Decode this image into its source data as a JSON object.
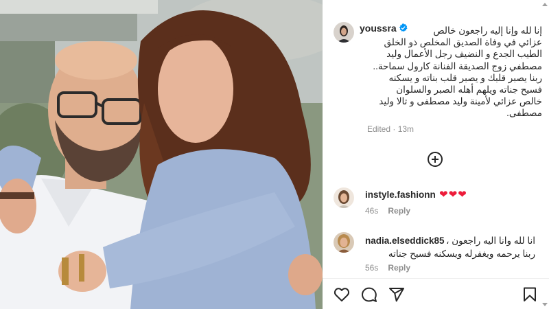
{
  "post": {
    "photo_alt": "Photo of two people embracing",
    "author": {
      "username": "youssra",
      "verified": true
    },
    "caption_lines": [
      "إنا لله وإنا إليه راجعون خالص",
      "عزائي في وفاة الصديق المخلص ذو الخلق",
      "الطيب الجدع و النضيف رجل الأعمال وليد",
      "مصطفي زوج الصديقة الفنانة كارول سماحة..",
      "ربنا يصبر قلبك و يصبر قلب بناته و يسكنه",
      "فسيح جناته ويلهم أهله الصبر والسلوان",
      "خالص عزائي لأمينة وليد مصطفى و تالا وليد",
      "مصطفى."
    ],
    "edited_label": "Edited",
    "edited_time": "13m"
  },
  "comments": [
    {
      "username": "instyle.fashionn",
      "text": "❤❤❤",
      "time": "46s",
      "reply_label": "Reply"
    },
    {
      "username": "nadia.elseddick85",
      "text_line1": "انا لله وانا اليه راجعون ،",
      "text_line2": "ربنا يرحمه ويغفرله ويسكنه فسيح جناته",
      "time": "56s",
      "reply_label": "Reply"
    }
  ],
  "icons": {
    "like": "heart-icon",
    "comment": "comment-icon",
    "share": "paper-plane-icon",
    "save": "bookmark-icon",
    "load_more": "plus-circle-icon",
    "verified": "verified-badge-icon"
  },
  "colors": {
    "text": "#262626",
    "secondary": "#8e8e8e",
    "verified": "#0095f6",
    "heart": "#ed1c3a"
  }
}
